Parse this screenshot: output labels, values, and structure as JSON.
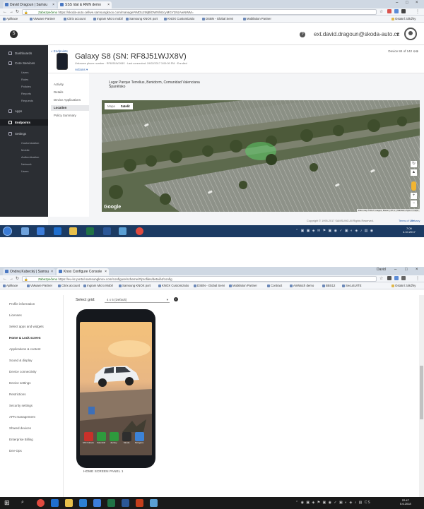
{
  "screenshot1": {
    "browser": {
      "tabs": [
        {
          "title": "David Dragoun | Samsu"
        },
        {
          "title": "SSS Idal & RMN demo"
        }
      ],
      "secure_label": "Zabezpečeno",
      "url": "https://skoda-auto.cellwe.samsungknox.com/manage#rMDUzMjBlOWNlNzcyMGY2NzAwNWM=",
      "bookmarks": [
        "Aplikace",
        "VMware Partner",
        "Citrix account",
        "Ingram Micro mobil",
        "Samsung KNOX port",
        "KNOX Customizatio",
        "DSBN - Global Servi",
        "Mobilation Partner",
        "Ostatní záložky"
      ]
    },
    "knox_header": {
      "user_email": "ext.david.dragoun@skoda-auto.cz",
      "help_symbol": "?",
      "logo_symbol": "S"
    },
    "sidebar": {
      "items": [
        {
          "label": "Dashboards",
          "icon": "dashboard-icon"
        },
        {
          "label": "Core Services",
          "icon": "services-icon"
        }
      ],
      "core_sub": [
        "Users",
        "Roles",
        "Policies",
        "Reports",
        "Requests"
      ],
      "apps_label": "Apps",
      "endpoints_label": "Endpoints",
      "settings_label": "Settings",
      "settings_sub": [
        "Customization",
        "Mobile",
        "Authentication",
        "Network",
        "Users"
      ]
    },
    "device": {
      "back_label": "« Endpoints",
      "title": "Galaxy S8 (SN: RF8J51WJX8V)",
      "subtitle": "Unknown phone number · RF8J51WJX8V · Last connected: 19/02/2017 3:09:09 PM · Enrolled",
      "actions_label": "Actions ▾",
      "pager": "Device 84 of 142"
    },
    "device_nav": [
      "Activity",
      "Details",
      "Device Applications",
      "Location",
      "Policy Summary"
    ],
    "location": {
      "address_line1": "Lugar Parque Terrelius, Benidorm, Comunidad Valenciana",
      "address_line2": "Španělsko"
    },
    "map": {
      "toggle_map": "Mapa",
      "toggle_satellite": "Satelit",
      "google": "Google",
      "attribution": "Data map ©2017 Images, Maxar | 20 m | Nahlásit chybu v mapě"
    },
    "footer": {
      "copyright": "Copyright © 1995-2017 SAMSUNG All Rights Reserved.",
      "terms": "Terms of Use",
      "privacy": "Privacy"
    },
    "taskbar": {
      "time": "7:09",
      "date": "4.10.2017"
    }
  },
  "screenshot2": {
    "browser": {
      "tabs": [
        {
          "title": "Ondrej Kubecký | Samsu"
        },
        {
          "title": "Knox Configure Console"
        }
      ],
      "user_badge": "David",
      "secure_label": "Zabezpečeno",
      "url": "https://eu-kc.portal.samsungknox.com/configure/scheme/#/profiles/detail/4/config",
      "bookmarks": [
        "Aplikace",
        "VMware Partner",
        "Citrix account",
        "Ingram Micro Mobil",
        "Samsung KNOX port",
        "KNOX Customizatio",
        "DSBN - Global Servi",
        "Mobilation Partner",
        "Contract",
        "AirWatch demo",
        "BBS12",
        "SecuSUITE",
        "Ostatní záložky"
      ]
    },
    "sidebar": {
      "items": [
        "Profile information",
        "Licenses",
        "Select apps and widgets",
        "Home & Lock screen",
        "Applications & content",
        "Sound & display",
        "Device connectivity",
        "Device settings",
        "Restrictions",
        "Security settings",
        "APN management",
        "Shared devices",
        "Enterprise Billing",
        "Dev-Ops"
      ],
      "active_index": 3
    },
    "content": {
      "select_grid_label": "Select grid:",
      "select_grid_value": "4 x 5 (Default)",
      "caption": "HOME SCREEN PANEL 1",
      "apps": [
        "MS Outlook",
        "Kalendář",
        "Zprávy",
        "Skoda",
        "Navigace"
      ]
    },
    "taskbar": {
      "time": "22:47",
      "date": "5.6.2018"
    }
  }
}
